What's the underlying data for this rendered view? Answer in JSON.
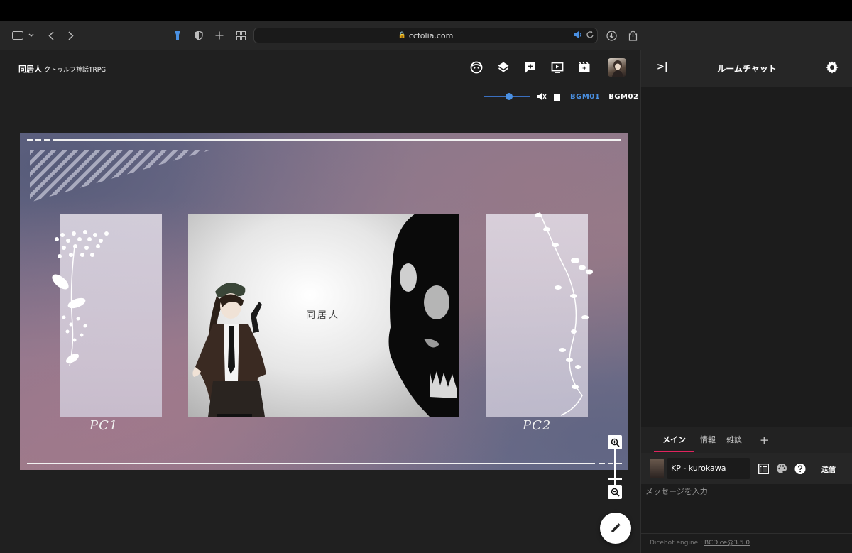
{
  "browser": {
    "url": "ccfolia.com",
    "icons": [
      "sidebar-icon",
      "chevron-down-icon",
      "back-icon",
      "forward-icon",
      "flashlight-icon",
      "shield-icon",
      "new-tab-icon",
      "grid-icon",
      "sound-icon",
      "reload-icon",
      "download-icon",
      "share-icon"
    ]
  },
  "room": {
    "title": "同居人",
    "subtitle": "クトゥルフ神話TRPG"
  },
  "toolbar": {
    "icons": [
      "face-icon",
      "layers-icon",
      "add-comment-icon",
      "screen-icon",
      "scene-icon"
    ]
  },
  "bgm": {
    "volume": 0.55,
    "bgm01": "BGM01",
    "bgm02": "BGM02",
    "accent": "#4a90e2"
  },
  "board": {
    "center_title": "同居人",
    "pc1_label": "PC1",
    "pc2_label": "PC2"
  },
  "chat": {
    "title": "ルームチャット",
    "tabs": [
      {
        "label": "メイン",
        "active": true
      },
      {
        "label": "情報",
        "active": false
      },
      {
        "label": "雑談",
        "active": false
      }
    ],
    "tab_add": "+",
    "speaker_name": "KP - kurokawa",
    "send_label": "送信",
    "message_placeholder": "メッセージを入力",
    "dicebot_prefix": "Dicebot engine : ",
    "dicebot_link": "BCDice@3.5.0",
    "tab_accent": "#e0245e"
  }
}
